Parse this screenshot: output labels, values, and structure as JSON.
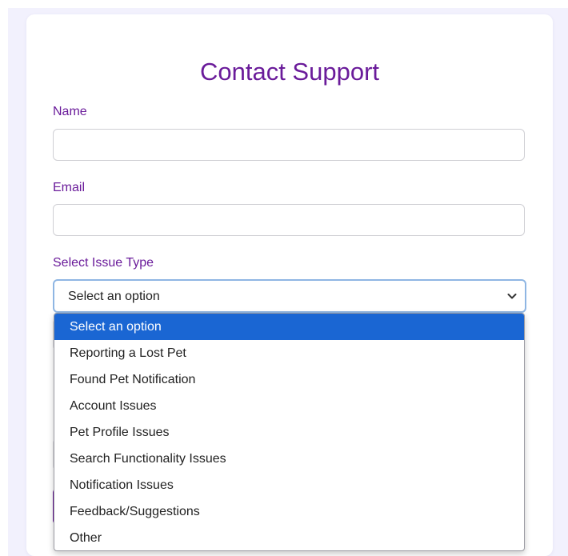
{
  "form": {
    "title": "Contact Support",
    "name_label": "Name",
    "name_value": "",
    "email_label": "Email",
    "email_value": "",
    "issue_label": "Select Issue Type",
    "issue_selected": "Select an option"
  },
  "dropdown": {
    "options": [
      "Select an option",
      "Reporting a Lost Pet",
      "Found Pet Notification",
      "Account Issues",
      "Pet Profile Issues",
      "Search Functionality Issues",
      "Notification Issues",
      "Feedback/Suggestions",
      "Other"
    ],
    "highlighted": "Select an option"
  },
  "colors": {
    "accent": "#6a1b9a",
    "page_background": "#f2f1fd",
    "option_highlight": "#1a66d3",
    "focus_border": "#8fb6e3"
  },
  "icons": {
    "select_arrow": "chevron-down-icon"
  }
}
